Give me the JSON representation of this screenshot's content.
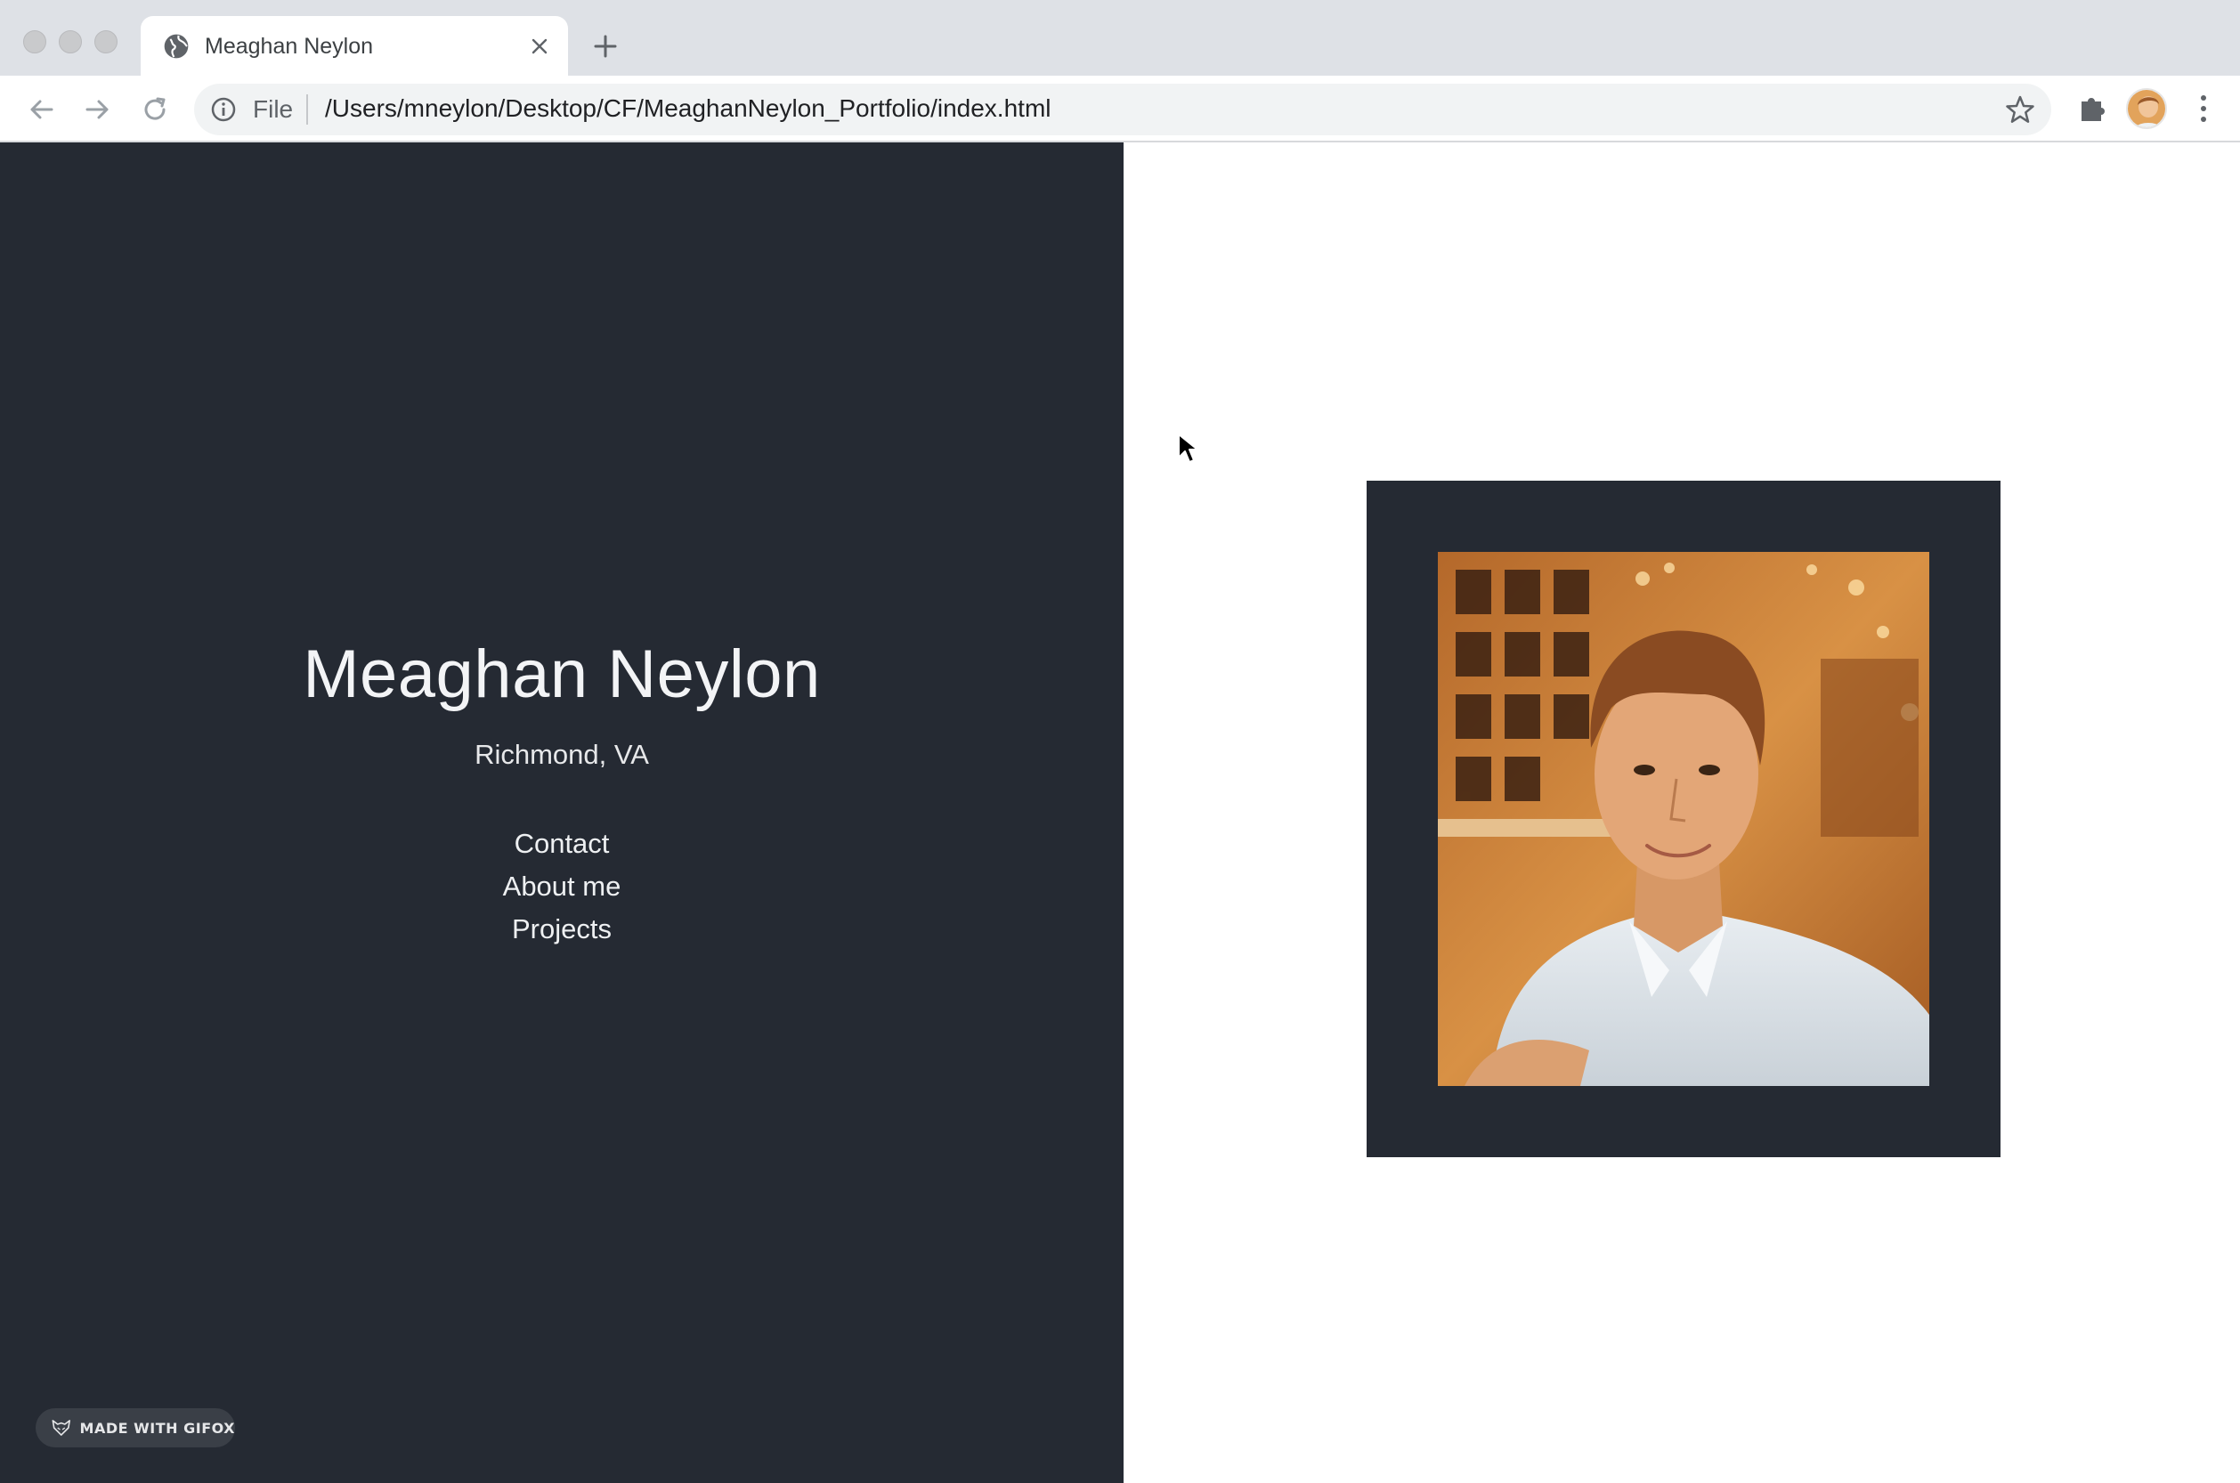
{
  "browser": {
    "tab_title": "Meaghan Neylon",
    "omnibox_scheme": "File",
    "url": "/Users/mneylon/Desktop/CF/MeaghanNeylon_Portfolio/index.html"
  },
  "page": {
    "name": "Meaghan Neylon",
    "location": "Richmond, VA",
    "nav": [
      "Contact",
      "About me",
      "Projects"
    ]
  },
  "badge": {
    "label": "MADE WITH GIFOX"
  },
  "colors": {
    "panel_dark": "#252a33",
    "text_light": "#ffffff",
    "chrome_bg": "#dee1e6"
  },
  "icons": {
    "favicon": "globe-icon",
    "close": "close-icon",
    "new_tab": "plus-icon",
    "back": "arrow-left-icon",
    "forward": "arrow-right-icon",
    "reload": "reload-icon",
    "info": "info-icon",
    "bookmark": "star-icon",
    "extensions": "puzzle-icon",
    "menu": "kebab-menu-icon",
    "badge": "fox-icon"
  }
}
